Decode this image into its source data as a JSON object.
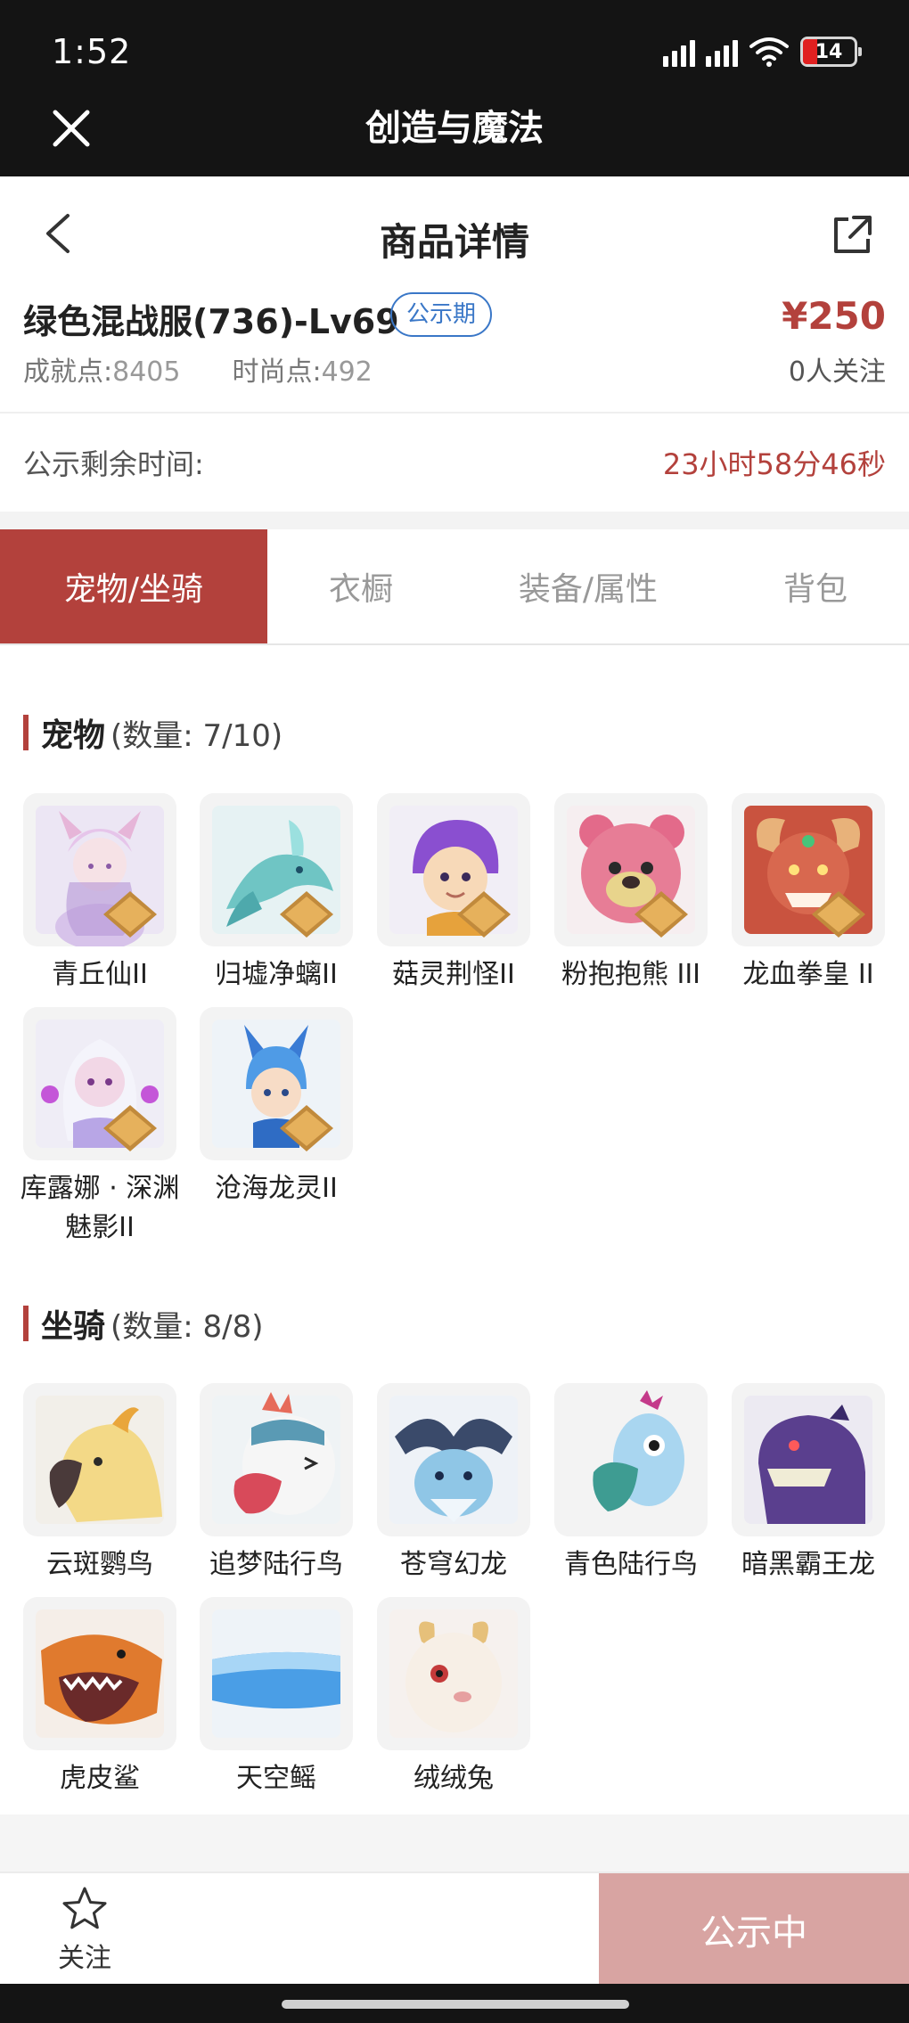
{
  "status": {
    "time": "1:52",
    "battery": "14"
  },
  "app": {
    "title": "创造与魔法"
  },
  "nav": {
    "title": "商品详情"
  },
  "product": {
    "name": "绿色混战服(736)-Lv69",
    "badge": "公示期",
    "price": "¥250",
    "achievement_label": "成就点:",
    "achievement_value": "8405",
    "fashion_label": "时尚点:",
    "fashion_value": "492",
    "followers": "0人关注",
    "remain_label": "公示剩余时间:",
    "remain_value": "23小时58分46秒"
  },
  "tabs": [
    {
      "label": "宠物/坐骑",
      "active": true
    },
    {
      "label": "衣橱",
      "active": false
    },
    {
      "label": "装备/属性",
      "active": false
    },
    {
      "label": "背包",
      "active": false
    }
  ],
  "pets": {
    "title": "宠物",
    "count": "(数量: 7/10)",
    "items": [
      {
        "name": "青丘仙II",
        "rank": "II"
      },
      {
        "name": "归墟净螭II",
        "rank": "II"
      },
      {
        "name": "菇灵荆怪II",
        "rank": "II"
      },
      {
        "name": "粉抱抱熊 III",
        "rank": "III"
      },
      {
        "name": "龙血拳皇 II",
        "rank": "II"
      },
      {
        "name": "库露娜 · 深渊魅影II",
        "rank": "II"
      },
      {
        "name": "沧海龙灵II",
        "rank": "II"
      }
    ]
  },
  "mounts": {
    "title": "坐骑",
    "count": "(数量: 8/8)",
    "items": [
      {
        "name": "云斑鹦鸟"
      },
      {
        "name": "追梦陆行鸟"
      },
      {
        "name": "苍穹幻龙"
      },
      {
        "name": "青色陆行鸟"
      },
      {
        "name": "暗黑霸王龙"
      },
      {
        "name": "虎皮鲨"
      },
      {
        "name": "天空鳐"
      },
      {
        "name": "绒绒兔"
      }
    ]
  },
  "bottom": {
    "follow_label": "关注",
    "public_label": "公示中"
  },
  "colors": {
    "accent": "#b3413c",
    "price": "#b3413c",
    "badge": "#3a77c7",
    "bar": "#141414"
  }
}
